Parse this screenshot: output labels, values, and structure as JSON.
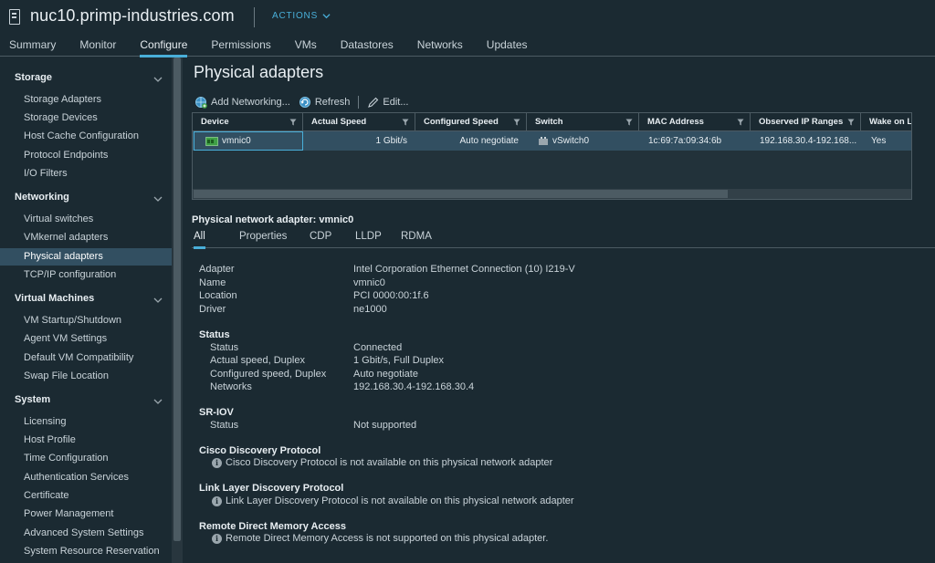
{
  "header": {
    "host_name": "nuc10.primp-industries.com",
    "actions_label": "ACTIONS",
    "tabs": [
      "Summary",
      "Monitor",
      "Configure",
      "Permissions",
      "VMs",
      "Datastores",
      "Networks",
      "Updates"
    ],
    "active_tab": "Configure"
  },
  "sidebar": {
    "groups": [
      {
        "label": "Storage",
        "items": [
          "Storage Adapters",
          "Storage Devices",
          "Host Cache Configuration",
          "Protocol Endpoints",
          "I/O Filters"
        ]
      },
      {
        "label": "Networking",
        "items": [
          "Virtual switches",
          "VMkernel adapters",
          "Physical adapters",
          "TCP/IP configuration"
        ]
      },
      {
        "label": "Virtual Machines",
        "items": [
          "VM Startup/Shutdown",
          "Agent VM Settings",
          "Default VM Compatibility",
          "Swap File Location"
        ]
      },
      {
        "label": "System",
        "items": [
          "Licensing",
          "Host Profile",
          "Time Configuration",
          "Authentication Services",
          "Certificate",
          "Power Management",
          "Advanced System Settings",
          "System Resource Reservation"
        ]
      }
    ],
    "active_item": "Physical adapters"
  },
  "main": {
    "title": "Physical adapters",
    "toolbar": {
      "add_networking": "Add Networking...",
      "refresh": "Refresh",
      "edit": "Edit..."
    },
    "grid": {
      "columns": [
        "Device",
        "Actual Speed",
        "Configured Speed",
        "Switch",
        "MAC Address",
        "Observed IP Ranges",
        "Wake on L"
      ],
      "rows": [
        {
          "device": "vmnic0",
          "actual_speed": "1 Gbit/s",
          "configured_speed": "Auto negotiate",
          "switch": "vSwitch0",
          "mac": "1c:69:7a:09:34:6b",
          "ip_ranges": "192.168.30.4-192.168...",
          "wake_on_lan": "Yes"
        }
      ]
    },
    "detail": {
      "title": "Physical network adapter: vmnic0",
      "tabs": [
        "All",
        "Properties",
        "CDP",
        "LLDP",
        "RDMA"
      ],
      "active_tab": "All",
      "general": [
        {
          "label": "Adapter",
          "value": "Intel Corporation Ethernet Connection (10) I219-V"
        },
        {
          "label": "Name",
          "value": "vmnic0"
        },
        {
          "label": "Location",
          "value": "PCI 0000:00:1f.6"
        },
        {
          "label": "Driver",
          "value": "ne1000"
        }
      ],
      "status": {
        "heading": "Status",
        "rows": [
          {
            "label": "Status",
            "value": "Connected"
          },
          {
            "label": "Actual speed, Duplex",
            "value": "1 Gbit/s, Full Duplex"
          },
          {
            "label": "Configured speed, Duplex",
            "value": "Auto negotiate"
          },
          {
            "label": "Networks",
            "value": "192.168.30.4-192.168.30.4"
          }
        ]
      },
      "sriov": {
        "heading": "SR-IOV",
        "label": "Status",
        "value": "Not supported"
      },
      "cdp": {
        "heading": "Cisco Discovery Protocol",
        "message": "Cisco Discovery Protocol is not available on this physical network adapter"
      },
      "lldp": {
        "heading": "Link Layer Discovery Protocol",
        "message": "Link Layer Discovery Protocol is not available on this physical network adapter"
      },
      "rdma": {
        "heading": "Remote Direct Memory Access",
        "message": "Remote Direct Memory Access is not supported on this physical adapter."
      }
    }
  },
  "colors": {
    "accent": "#49afd9",
    "background": "#1b2a32",
    "selected": "#324f61"
  }
}
